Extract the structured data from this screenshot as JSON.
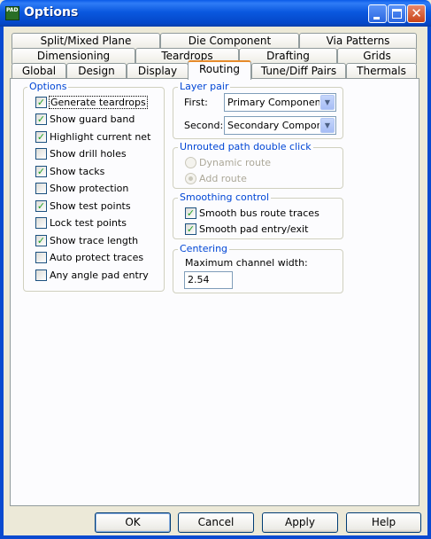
{
  "window": {
    "title": "Options",
    "icon_text": "PADS"
  },
  "tabs": {
    "row1": [
      "Split/Mixed Plane",
      "Die Component",
      "Via Patterns"
    ],
    "row2": [
      "Dimensioning",
      "Teardrops",
      "Drafting",
      "Grids"
    ],
    "row3": [
      "Global",
      "Design",
      "Display",
      "Routing",
      "Tune/Diff Pairs",
      "Thermals"
    ],
    "active": "Routing"
  },
  "options_group": {
    "label": "Options",
    "items": [
      {
        "label": "Generate teardrops",
        "checked": true
      },
      {
        "label": "Show guard band",
        "checked": true
      },
      {
        "label": "Highlight current net",
        "checked": true
      },
      {
        "label": "Show drill holes",
        "checked": false
      },
      {
        "label": "Show tacks",
        "checked": true
      },
      {
        "label": "Show protection",
        "checked": false
      },
      {
        "label": "Show test points",
        "checked": true
      },
      {
        "label": "Lock test points",
        "checked": false
      },
      {
        "label": "Show trace length",
        "checked": true
      },
      {
        "label": "Auto protect traces",
        "checked": false
      },
      {
        "label": "Any angle pad entry",
        "checked": false
      }
    ]
  },
  "layer_pair": {
    "label": "Layer pair",
    "first_label": "First:",
    "first_value": "Primary Component Si",
    "second_label": "Second:",
    "second_value": "Secondary Componer"
  },
  "unrouted": {
    "label": "Unrouted path double click",
    "options": [
      {
        "label": "Dynamic route",
        "selected": false
      },
      {
        "label": "Add route",
        "selected": true
      }
    ]
  },
  "smoothing": {
    "label": "Smoothing control",
    "items": [
      {
        "label": "Smooth bus route traces",
        "checked": true
      },
      {
        "label": "Smooth pad entry/exit",
        "checked": true
      }
    ]
  },
  "centering": {
    "label": "Centering",
    "field_label": "Maximum channel width:",
    "field_value": "2.54"
  },
  "buttons": {
    "ok": "OK",
    "cancel": "Cancel",
    "apply": "Apply",
    "help": "Help"
  },
  "colors": {
    "titlebar": "#0a58df",
    "group_label": "#0046d5",
    "active_tab_accent": "#e68b2c",
    "check": "#21a121"
  }
}
